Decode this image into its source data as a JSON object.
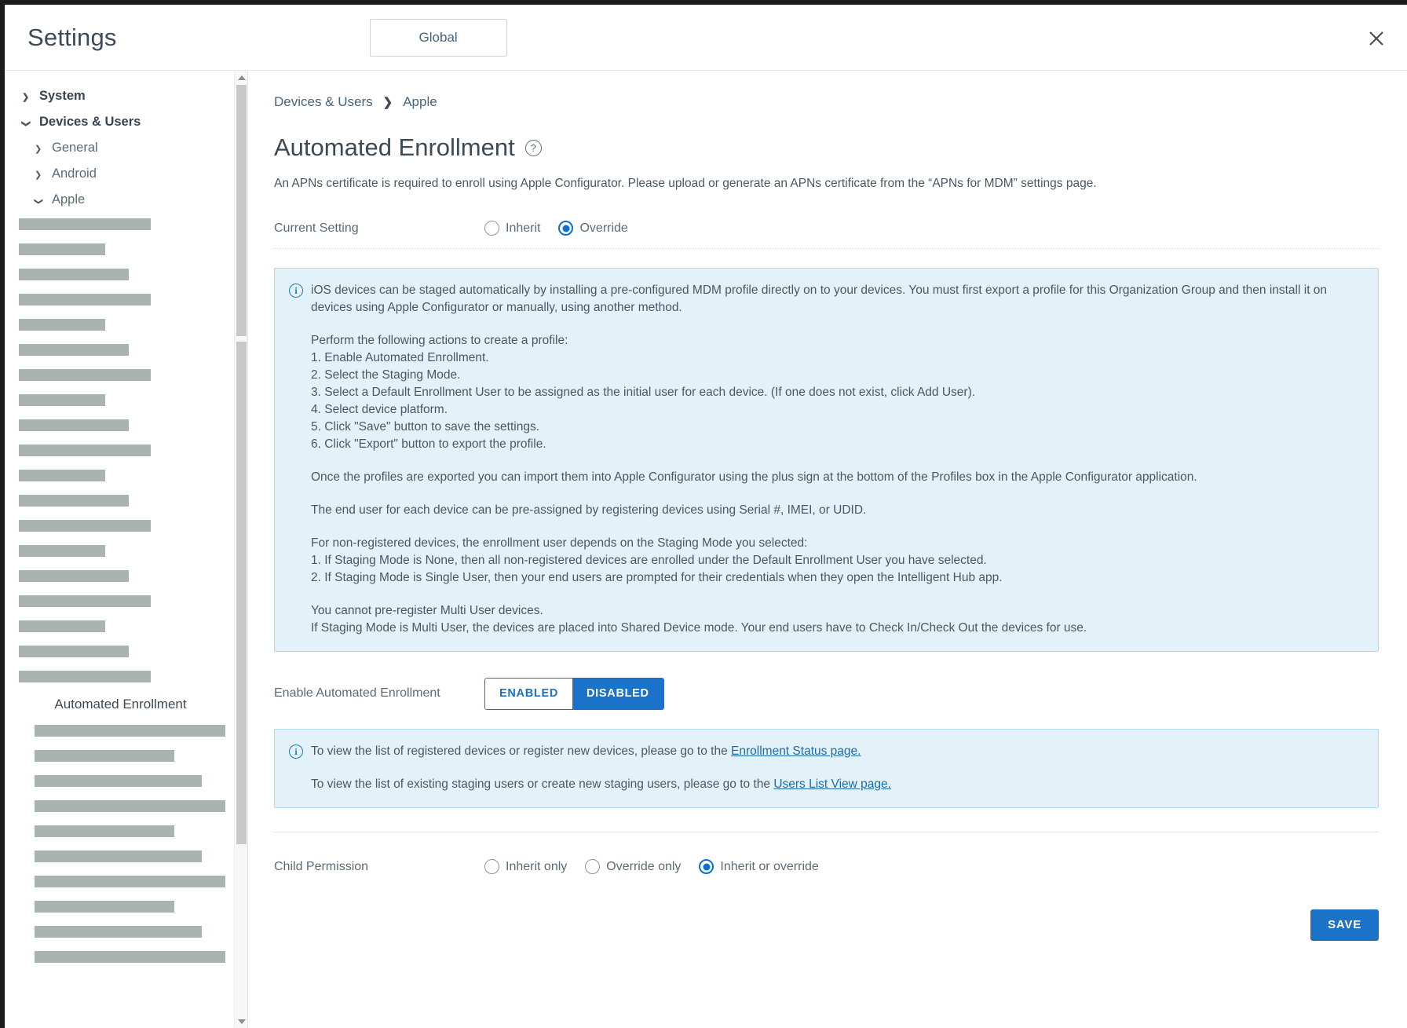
{
  "header": {
    "title": "Settings",
    "org_group_button": "Global",
    "close_icon": "close-icon"
  },
  "sidebar": {
    "tree": [
      {
        "label": "System",
        "level": 1,
        "expanded": false
      },
      {
        "label": "Devices & Users",
        "level": 1,
        "expanded": true
      },
      {
        "label": "General",
        "level": 2,
        "expanded": false
      },
      {
        "label": "Android",
        "level": 2,
        "expanded": false
      },
      {
        "label": "Apple",
        "level": 2,
        "expanded": true
      }
    ],
    "selected_item": "Automated Enrollment",
    "redacted_group_one": [
      "wide",
      "narrow",
      "mid",
      "wide",
      "narrow",
      "mid",
      "wide",
      "narrow",
      "mid",
      "wide",
      "narrow",
      "mid",
      "wide",
      "narrow",
      "mid",
      "wide",
      "narrow",
      "mid",
      "wide"
    ],
    "redacted_group_two": [
      "wide",
      "narrow",
      "mid",
      "wide",
      "narrow",
      "mid",
      "wide",
      "narrow",
      "mid",
      "wide"
    ],
    "scrollbar": {
      "up_arrow": "scroll-up-arrow",
      "down_arrow": "scroll-down-arrow"
    }
  },
  "main": {
    "breadcrumb": {
      "parent": "Devices & Users",
      "separator": "❯",
      "current": "Apple"
    },
    "page_title": "Automated Enrollment",
    "help_icon_glyph": "?",
    "page_description": "An APNs certificate is required to enroll using Apple Configurator. Please upload or generate an APNs certificate from the “APNs for MDM” settings page.",
    "current_setting": {
      "label": "Current Setting",
      "options": [
        {
          "label": "Inherit",
          "selected": false
        },
        {
          "label": "Override",
          "selected": true
        }
      ]
    },
    "info_box_main": {
      "icon": "info-icon",
      "paragraph1": "iOS devices can be staged automatically by installing a pre-configured MDM profile directly on to your devices. You must first export a profile for this Organization Group and then install it on devices using Apple Configurator or manually, using another method.",
      "steps_intro": "Perform the following actions to create a profile:",
      "steps": [
        "1. Enable Automated Enrollment.",
        "2. Select the Staging Mode.",
        "3. Select a Default Enrollment User to be assigned as the initial user for each device. (If one does not exist, click Add User).",
        "4. Select device platform.",
        "5. Click \"Save\" button to save the settings.",
        "6. Click \"Export\" button to export the profile."
      ],
      "paragraph2": "Once the profiles are exported you can import them into Apple Configurator using the plus sign at the bottom of the Profiles box in the Apple Configurator application.",
      "paragraph3": "The end user for each device can be pre-assigned by registering devices using Serial #, IMEI, or UDID.",
      "staging_intro": "For non-registered devices, the enrollment user depends on the Staging Mode you selected:",
      "staging_items": [
        "1. If Staging Mode is None, then all non-registered devices are enrolled under the Default Enrollment User you have selected.",
        "2. If Staging Mode is Single User, then your end users are prompted for their credentials when they open the Intelligent Hub app."
      ],
      "multi_user_line1": "You cannot pre-register Multi User devices.",
      "multi_user_line2": "If Staging Mode is Multi User, the devices are placed into Shared Device mode. Your end users have to Check In/Check Out the devices for use."
    },
    "enable_row": {
      "label": "Enable Automated Enrollment",
      "enabled_label": "ENABLED",
      "disabled_label": "DISABLED",
      "selected": "DISABLED"
    },
    "info_box_links": {
      "icon": "info-icon",
      "line1_prefix": "To view the list of registered devices or register new devices, please go to the ",
      "line1_link": "Enrollment Status page.",
      "line2_prefix": "To view the list of existing staging users or create new staging users, please go to the ",
      "line2_link": "Users List View page."
    },
    "child_permission": {
      "label": "Child Permission",
      "options": [
        {
          "label": "Inherit only",
          "selected": false
        },
        {
          "label": "Override only",
          "selected": false
        },
        {
          "label": "Inherit or override",
          "selected": true
        }
      ]
    },
    "save_button": "SAVE"
  },
  "colors": {
    "accent_blue": "#1a73c8",
    "radio_blue": "#0b70d1",
    "info_bg": "#e3f1f8",
    "info_border": "#addbee",
    "link_blue": "#1f6ba8",
    "redact_gray": "#a9b3b2",
    "text_dark": "#3c4a56"
  }
}
